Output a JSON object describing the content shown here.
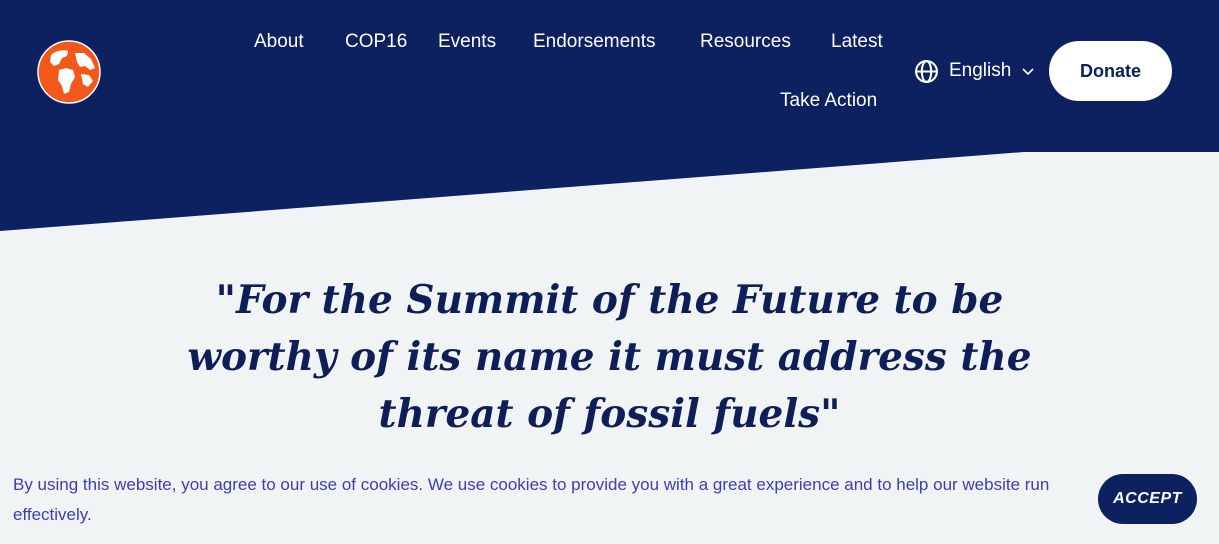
{
  "header": {
    "nav": [
      {
        "label": "About"
      },
      {
        "label": "COP16"
      },
      {
        "label": "Events"
      },
      {
        "label": "Endorsements"
      },
      {
        "label": "Resources"
      },
      {
        "label": "Latest"
      },
      {
        "label": "Take Action"
      }
    ],
    "language": {
      "label": "English",
      "icon": "globe-icon"
    },
    "donate_label": "Donate",
    "logo_icon": "earth-globe-icon",
    "colors": {
      "navy": "#0d2060",
      "logo_orange": "#f2581a",
      "background": "#f1f4f5"
    }
  },
  "hero": {
    "quote": "\"For the Summit of the Future to be worthy of its name it must address the threat of fossil fuels\""
  },
  "cookie_banner": {
    "text": "By using this website, you agree to our use of cookies. We use cookies to provide you with a great experience and to help our website run effectively.",
    "accept_label": "ACCEPT",
    "text_color": "#3b3fb0"
  }
}
